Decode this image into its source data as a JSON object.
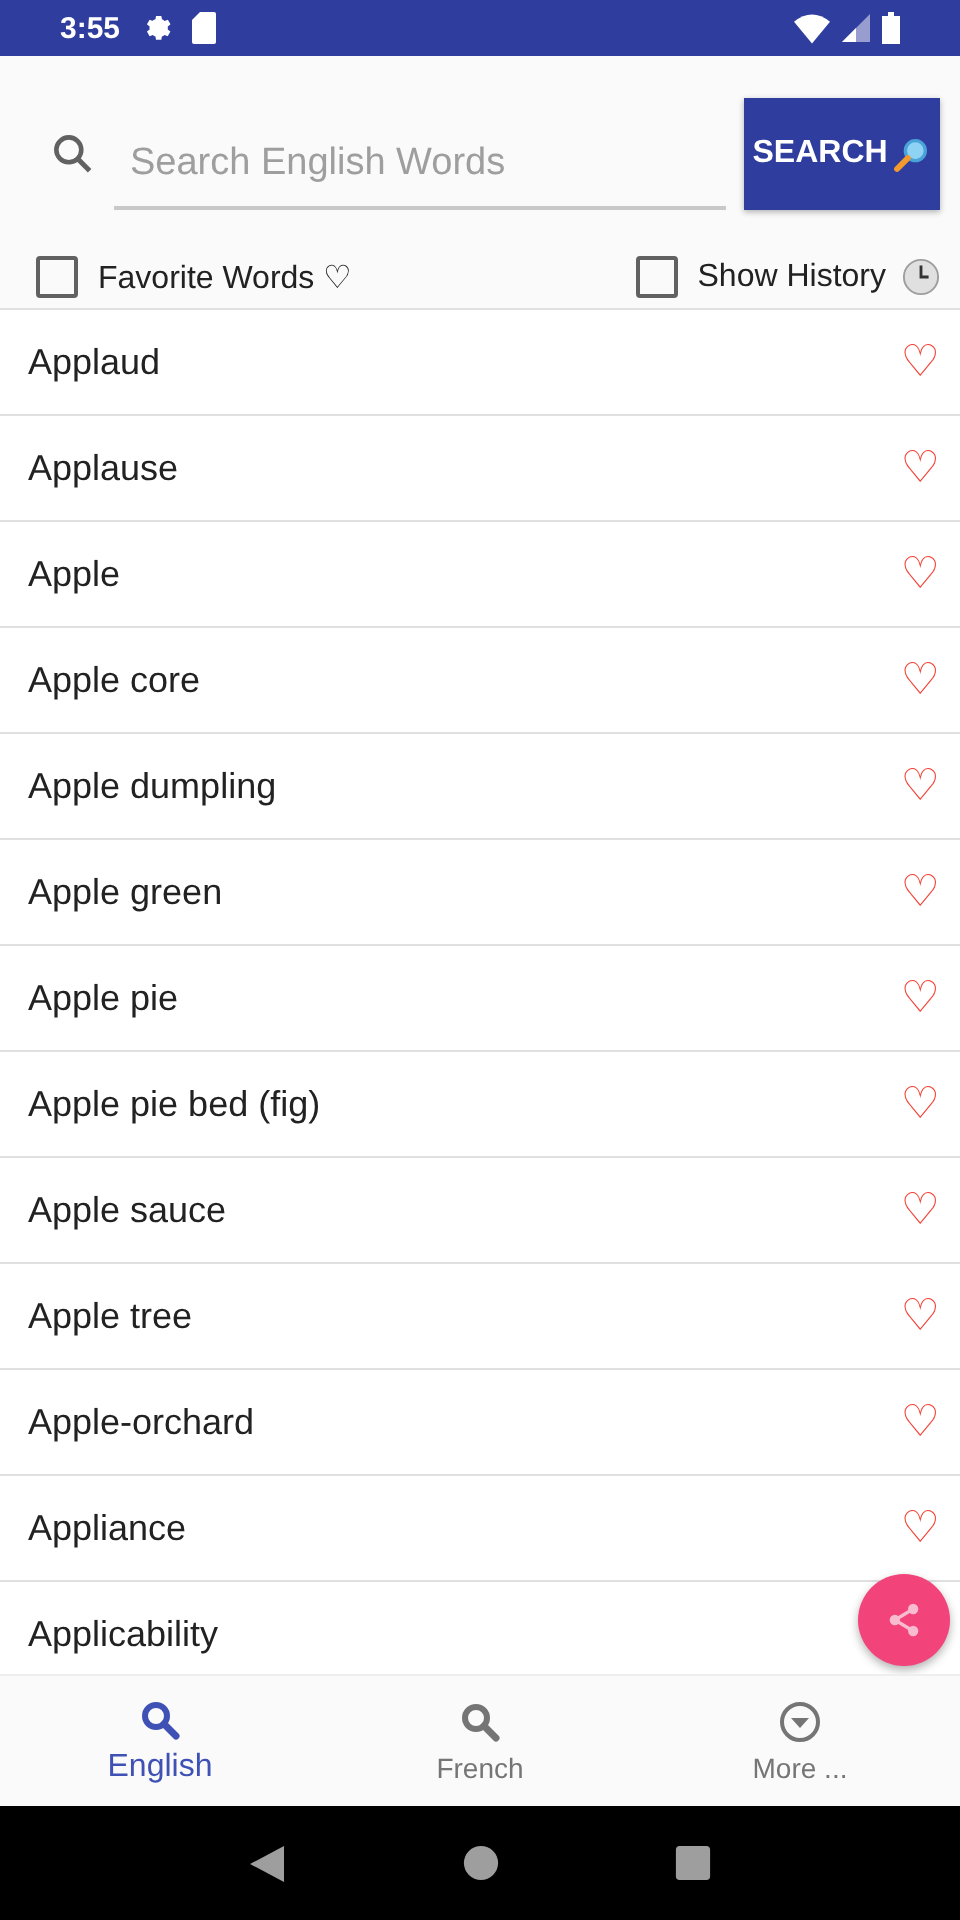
{
  "status_bar": {
    "time": "3:55"
  },
  "search": {
    "placeholder": "Search English Words",
    "button": "SEARCH"
  },
  "filters": [
    {
      "label": "Favorite Words ♡",
      "checked": false,
      "kind": "plain"
    },
    {
      "label": "Show History",
      "checked": false,
      "kind": "clock"
    }
  ],
  "words": [
    {
      "text": "Applaud",
      "mark": "♡"
    },
    {
      "text": "Applause",
      "mark": "♡"
    },
    {
      "text": "Apple",
      "mark": "♡"
    },
    {
      "text": "Apple core",
      "mark": "♡"
    },
    {
      "text": "Apple dumpling",
      "mark": "♡"
    },
    {
      "text": "Apple green",
      "mark": "♡"
    },
    {
      "text": "Apple pie",
      "mark": "♡"
    },
    {
      "text": "Apple pie bed (fig)",
      "mark": "♡"
    },
    {
      "text": "Apple sauce",
      "mark": "♡"
    },
    {
      "text": "Apple tree",
      "mark": "♡"
    },
    {
      "text": "Apple-orchard",
      "mark": "♡"
    },
    {
      "text": "Appliance",
      "mark": "♡"
    },
    {
      "text": "Applicability"
    }
  ],
  "tabs": [
    {
      "label": "English",
      "selected": true,
      "kind": "search"
    },
    {
      "label": "French",
      "selected": false,
      "kind": "search"
    },
    {
      "label": "More ...",
      "selected": false,
      "kind": "more"
    }
  ]
}
